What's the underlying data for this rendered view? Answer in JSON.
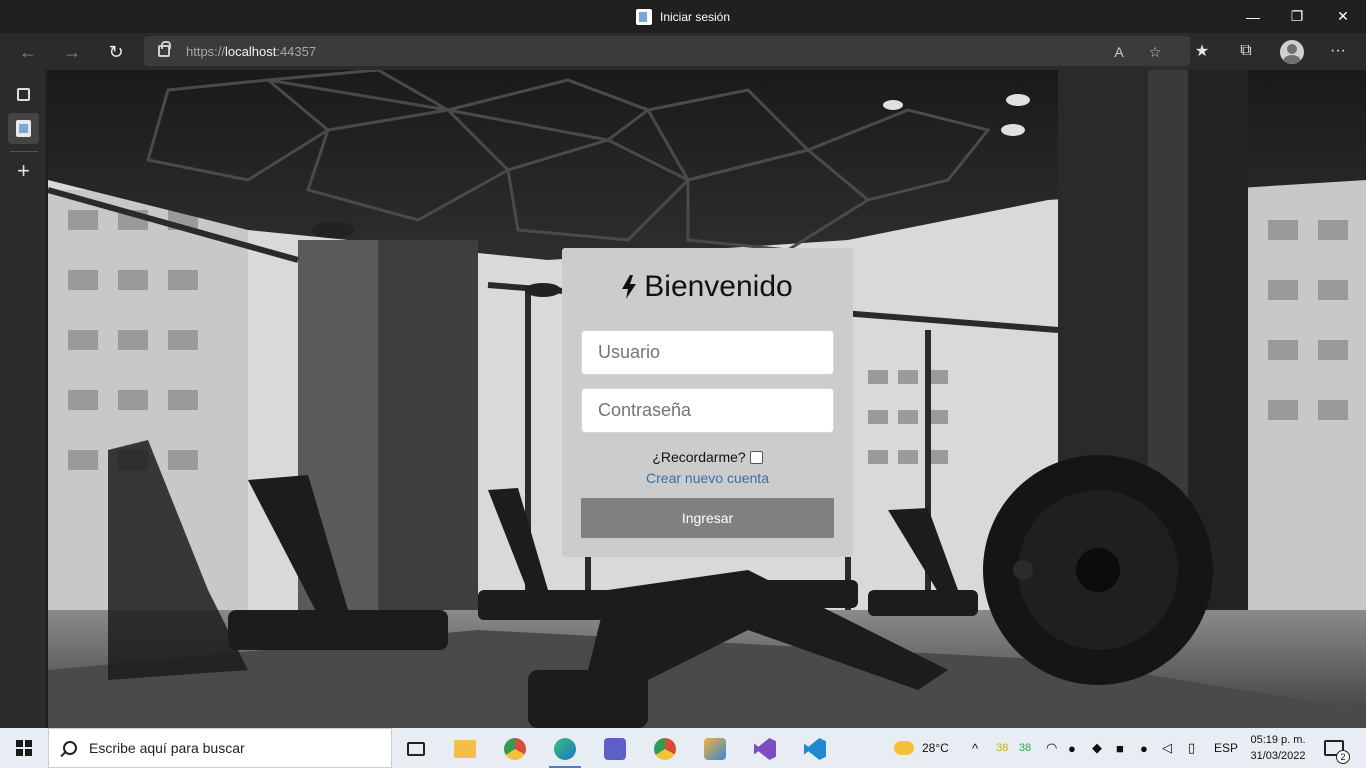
{
  "window": {
    "title": "Iniciar sesión",
    "minimize": "—",
    "restore": "❐",
    "close": "✕"
  },
  "navbar": {
    "back_icon": "←",
    "forward_icon": "→",
    "refresh_icon": "↻",
    "url_prefix": "https://",
    "url_host": "localhost",
    "url_port": ":44357",
    "read_aloud_icon": "A",
    "favorite_icon": "☆",
    "favorites_icon": "★",
    "collections_icon": "⧉",
    "menu_icon": "···"
  },
  "sidetabs": {
    "new_tab_icon": "+"
  },
  "login": {
    "title": "Bienvenido",
    "username_placeholder": "Usuario",
    "password_placeholder": "Contraseña",
    "remember_label": "¿Recordarme?",
    "create_account_link": "Crear nuevo cuenta",
    "submit_label": "Ingresar"
  },
  "taskbar": {
    "search_placeholder": "Escribe aquí para buscar",
    "weather_temp": "28°C",
    "tray_num_a": "38",
    "tray_num_b": "38",
    "language": "ESP",
    "time": "05:19 p. m.",
    "date": "31/03/2022",
    "notifications_count": "2",
    "chevron_icon": "^"
  },
  "colors": {
    "accent_link": "#3a6ea5",
    "button_bg": "#808080",
    "card_bg": "#cccccc"
  }
}
